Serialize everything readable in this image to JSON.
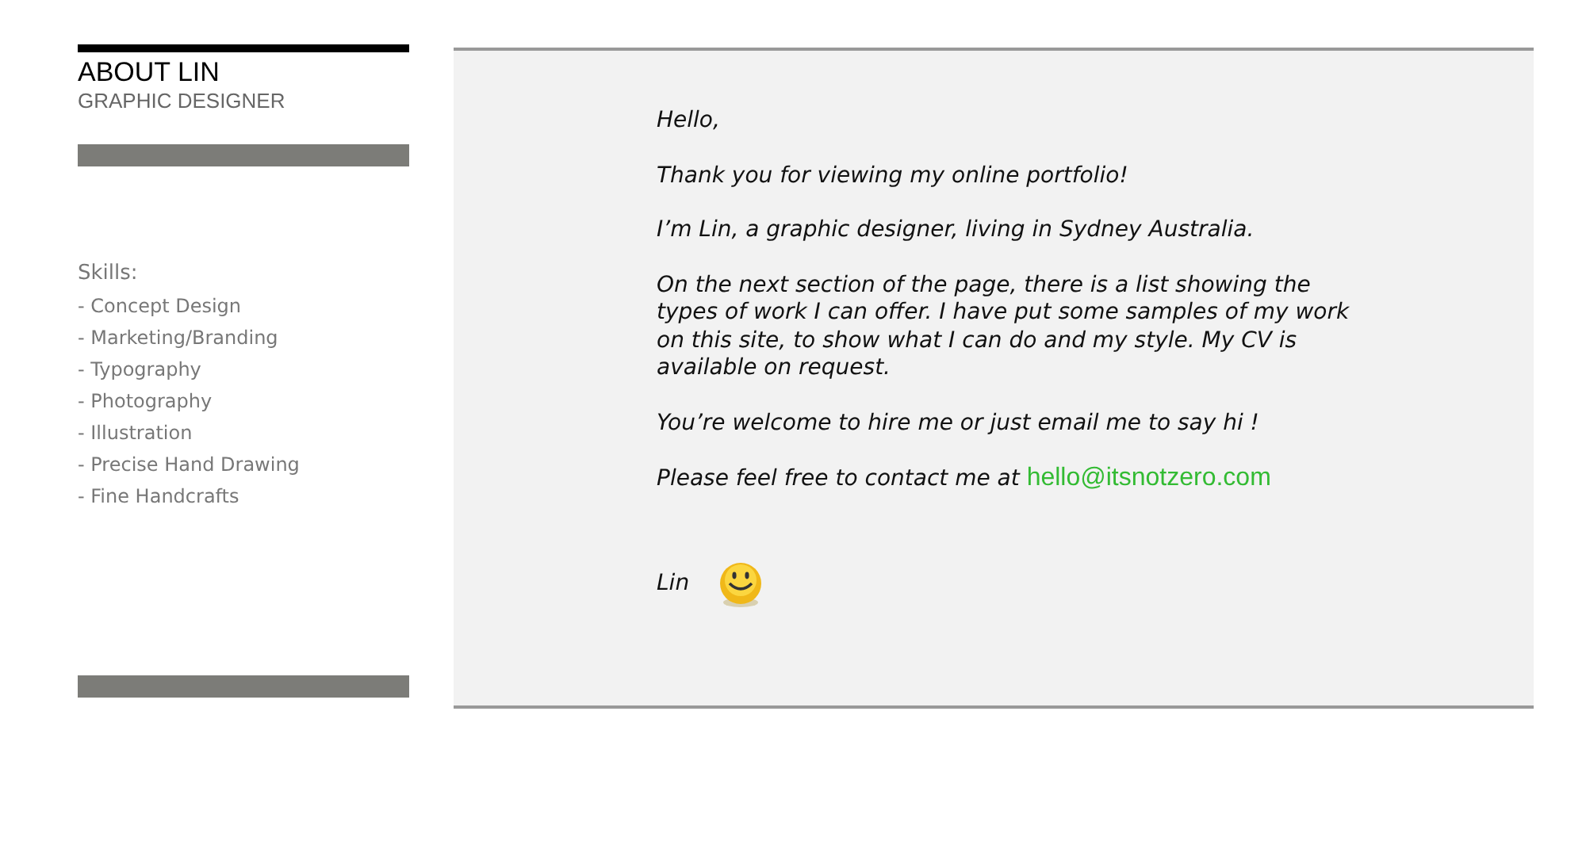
{
  "sidebar": {
    "title": "ABOUT LIN",
    "subtitle": "GRAPHIC DESIGNER",
    "skills_heading": "Skills:",
    "skills": [
      "- Concept Design",
      "- Marketing/Branding",
      "- Typography",
      "- Photography",
      "- Illustration",
      "- Precise Hand Drawing",
      "- Fine Handcrafts"
    ]
  },
  "content": {
    "greeting": "Hello,",
    "paragraphs": [
      "Thank you for viewing my online portfolio!",
      "I’m Lin, a graphic designer,  living in Sydney Australia.",
      "On the next section of the page, there is a list showing the types of work I can offer.  I have put some samples of my work on this site, to show what I can do and my style. My CV is available on request.",
      "You’re welcome to hire me or just email me to say hi !"
    ],
    "contact_text": "Please feel free to contact me at",
    "email": "hello@itsnotzero.com",
    "signature": "Lin"
  }
}
